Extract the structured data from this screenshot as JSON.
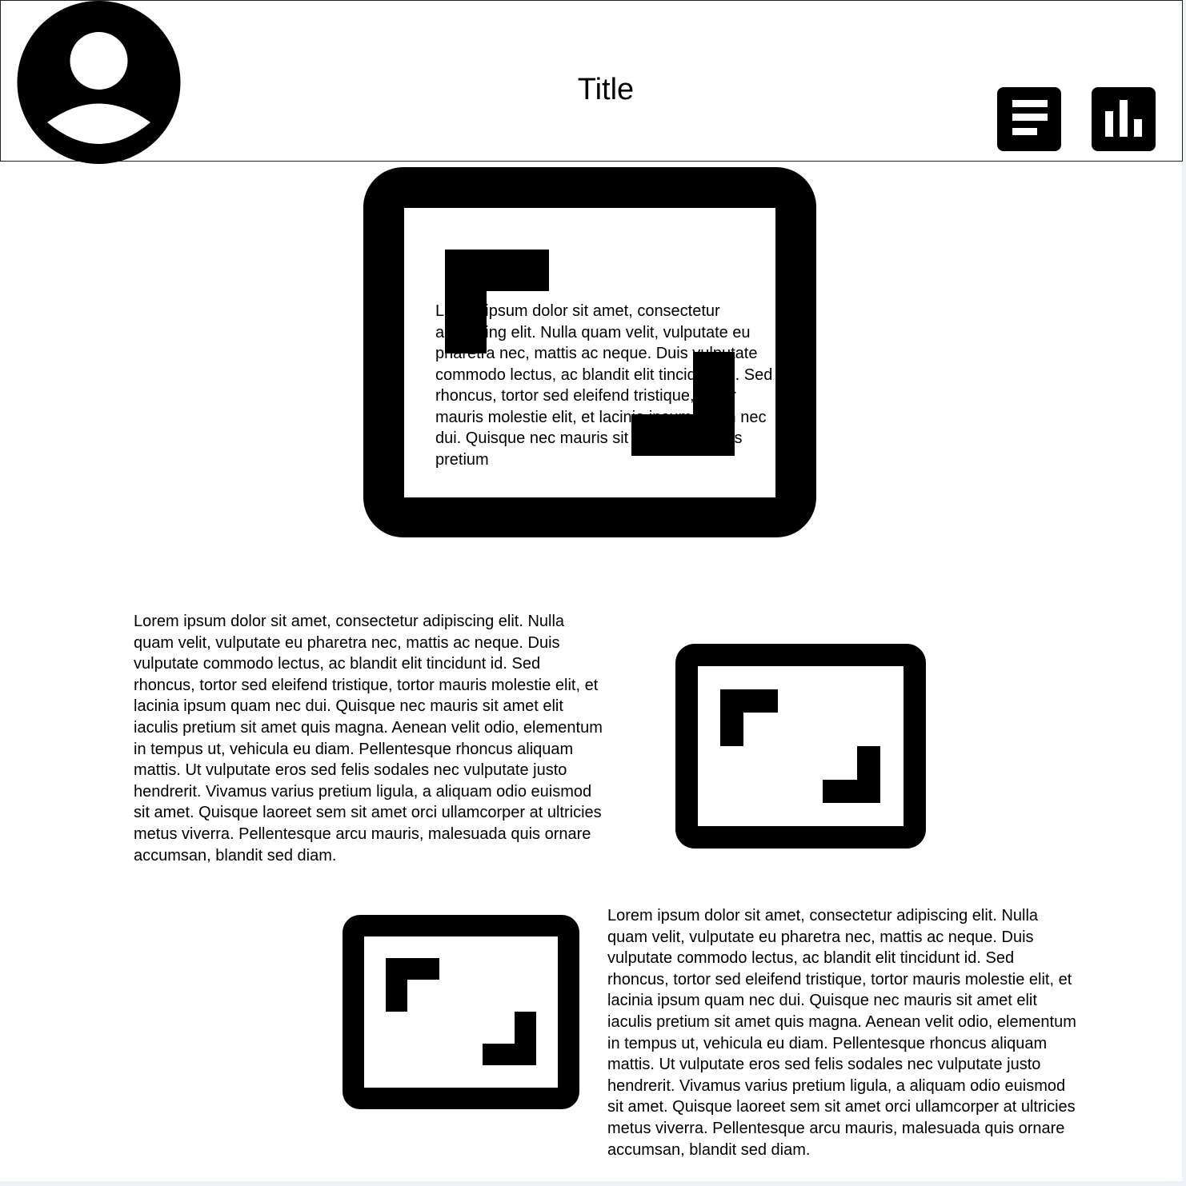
{
  "header": {
    "title": "Title",
    "avatar_icon": "user-avatar-icon",
    "menu_button_icon": "text-lines-icon",
    "chart_button_icon": "bar-chart-icon"
  },
  "hero": {
    "image_icon": "image-placeholder-icon",
    "text": "Lorem ipsum dolor sit amet, consectetur adipiscing elit. Nulla quam velit, vulputate eu pharetra nec, mattis ac neque. Duis vulputate commodo lectus, ac blandit elit tincidunt id. Sed rhoncus, tortor sed eleifend tristique, tortor mauris molestie elit, et lacinia ipsum quam nec dui. Quisque nec mauris sit amet elit iaculis pretium"
  },
  "section1": {
    "text": "Lorem ipsum dolor sit amet, consectetur adipiscing elit. Nulla quam velit, vulputate eu pharetra nec, mattis ac neque. Duis vulputate commodo lectus, ac blandit elit tincidunt id. Sed rhoncus, tortor sed eleifend tristique, tortor mauris molestie elit, et lacinia ipsum quam nec dui. Quisque nec mauris sit amet elit iaculis pretium sit amet quis magna. Aenean velit odio, elementum in tempus ut, vehicula eu diam. Pellentesque rhoncus aliquam mattis. Ut vulputate eros sed felis sodales nec vulputate justo hendrerit. Vivamus varius pretium ligula, a aliquam odio euismod sit amet. Quisque laoreet sem sit amet orci ullamcorper at ultricies metus viverra. Pellentesque arcu mauris, malesuada quis ornare accumsan, blandit sed diam.",
    "image_icon": "image-placeholder-icon"
  },
  "section2": {
    "image_icon": "image-placeholder-icon",
    "text": "Lorem ipsum dolor sit amet, consectetur adipiscing elit. Nulla quam velit, vulputate eu pharetra nec, mattis ac neque. Duis vulputate commodo lectus, ac blandit elit tincidunt id. Sed rhoncus, tortor sed eleifend tristique, tortor mauris molestie elit, et lacinia ipsum quam nec dui. Quisque nec mauris sit amet elit iaculis pretium sit amet quis magna. Aenean velit odio, elementum in tempus ut, vehicula eu diam. Pellentesque rhoncus aliquam mattis. Ut vulputate eros sed felis sodales nec vulputate justo hendrerit. Vivamus varius pretium ligula, a aliquam odio euismod sit amet. Quisque laoreet sem sit amet orci ullamcorper at ultricies metus viverra. Pellentesque arcu mauris, malesuada quis ornare accumsan, blandit sed diam."
  }
}
